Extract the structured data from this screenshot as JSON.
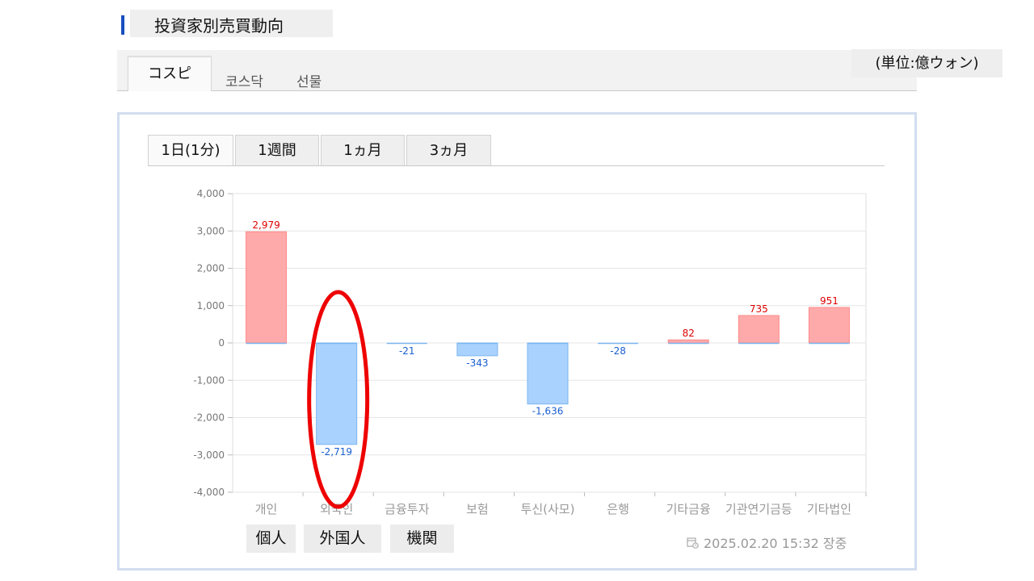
{
  "header": {
    "title": "投資家別売買動向"
  },
  "market_tabs": [
    {
      "label": "コスピ",
      "active": true
    },
    {
      "label": "코스닥",
      "active": false
    },
    {
      "label": "선물",
      "active": false
    }
  ],
  "unit_label": "(単位:億ウォン)",
  "period_tabs": [
    {
      "label": "1日(1分)",
      "active": true
    },
    {
      "label": "1週間",
      "active": false
    },
    {
      "label": "1ヵ月",
      "active": false
    },
    {
      "label": "3ヵ月",
      "active": false
    }
  ],
  "highlight_labels": [
    "個人",
    "外国人",
    "機関"
  ],
  "timestamp": "2025.02.20 15:32 장중",
  "colors": {
    "positive_fill": "#ffaaaa",
    "positive_stroke": "#ff8a8a",
    "negative_fill": "#aad2ff",
    "negative_stroke": "#7ab6f0",
    "positive_label": "#dd0000",
    "negative_label": "#1a5fd0",
    "annotation_ellipse": "#ee0000"
  },
  "chart_data": {
    "type": "bar",
    "categories": [
      "개인",
      "외국인",
      "금융투자",
      "보험",
      "투신(사모)",
      "은행",
      "기타금융",
      "기관연기금등",
      "기타법인"
    ],
    "values": [
      2979,
      -2719,
      -21,
      -343,
      -1636,
      -28,
      82,
      735,
      951
    ],
    "value_labels": [
      "2,979",
      "-2,719",
      "-21",
      "-343",
      "-1,636",
      "-28",
      "82",
      "735",
      "951"
    ],
    "y_ticks": [
      "4,000",
      "3,000",
      "2,000",
      "1,000",
      "0",
      "-1,000",
      "-2,000",
      "-3,000",
      "-4,000"
    ],
    "ylim": [
      -4000,
      4000
    ],
    "grid": true,
    "annotation": "red ellipse around 외국인 bar"
  }
}
